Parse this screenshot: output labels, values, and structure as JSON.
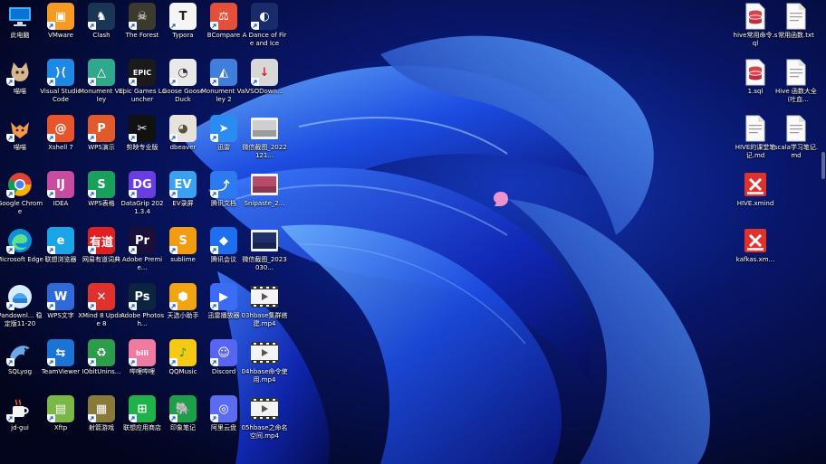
{
  "desktop": {
    "left_columns": [
      [
        {
          "name": "this-pc",
          "label": "此电脑",
          "kind": "pc",
          "color": "#1e90ff",
          "arrow": false
        },
        {
          "name": "meow",
          "label": "喵喵",
          "kind": "cat",
          "color": "#c9a37a",
          "arrow": true
        },
        {
          "name": "meowmeow",
          "label": "喵喵",
          "kind": "fox",
          "color": "#2aa1ff",
          "arrow": true
        },
        {
          "name": "google-chrome",
          "label": "Google Chrome",
          "kind": "chrome",
          "color": "#34a853",
          "arrow": true
        },
        {
          "name": "microsoft-edge",
          "label": "Microsoft Edge",
          "kind": "edge",
          "color": "#0a7ed9",
          "arrow": true
        },
        {
          "name": "pandownload",
          "label": "Pandownl... 稳定版11-20",
          "kind": "pan",
          "color": "#4fb3ff",
          "arrow": true
        },
        {
          "name": "sqlyog",
          "label": "SQLyog",
          "kind": "dolphin",
          "color": "#3b84d8",
          "arrow": true
        },
        {
          "name": "jd-gui",
          "label": "jd-gui",
          "kind": "coffee",
          "color": "#e6a23c",
          "arrow": true
        }
      ],
      [
        {
          "name": "vmware",
          "label": "VMware",
          "kind": "text",
          "text": "▣",
          "color": "#f59a23",
          "arrow": true
        },
        {
          "name": "vs-code",
          "label": "Visual Studio Code",
          "kind": "text",
          "text": "⟩⟨",
          "color": "#1e88e5",
          "arrow": true
        },
        {
          "name": "xshell",
          "label": "Xshell 7",
          "kind": "text",
          "text": "@",
          "color": "#e8552d",
          "arrow": true
        },
        {
          "name": "idea",
          "label": "IDEA",
          "kind": "text",
          "text": "IJ",
          "color": "#c74b9e",
          "arrow": true
        },
        {
          "name": "lenovo-browser",
          "label": "联想浏览器",
          "kind": "text",
          "text": "e",
          "color": "#1aa5e8",
          "arrow": true
        },
        {
          "name": "wps-writer",
          "label": "WPS文字",
          "kind": "text",
          "text": "W",
          "color": "#2f6bd8",
          "arrow": true
        },
        {
          "name": "teamviewer",
          "label": "TeamViewer",
          "kind": "text",
          "text": "⇆",
          "color": "#1b74d3",
          "arrow": true
        },
        {
          "name": "xftp",
          "label": "Xftp",
          "kind": "text",
          "text": "▤",
          "color": "#7ab648",
          "arrow": true
        }
      ],
      [
        {
          "name": "clash",
          "label": "Clash",
          "kind": "text",
          "text": "♞",
          "color": "#1b3557",
          "arrow": true
        },
        {
          "name": "monument-valley",
          "label": "Monument Valley",
          "kind": "text",
          "text": "△",
          "color": "#2fa88b",
          "arrow": true
        },
        {
          "name": "wps-presentation",
          "label": "WPS演示",
          "kind": "text",
          "text": "P",
          "color": "#e05a2b",
          "arrow": true
        },
        {
          "name": "wps-spreadsheet",
          "label": "WPS表格",
          "kind": "text",
          "text": "S",
          "color": "#19a05a",
          "arrow": true
        },
        {
          "name": "youdao-dict",
          "label": "网易有道词典",
          "kind": "text",
          "text": "有道",
          "color": "#e02020",
          "arrow": true
        },
        {
          "name": "xmind8",
          "label": "XMind 8 Update 8",
          "kind": "text",
          "text": "✕",
          "color": "#e0322d",
          "arrow": true
        },
        {
          "name": "iobit-uninstaller",
          "label": "IObitUnins...",
          "kind": "text",
          "text": "♻",
          "color": "#2c9d4a",
          "arrow": true
        },
        {
          "name": "lenovo-games",
          "label": "射箭游戏",
          "kind": "text",
          "text": "▦",
          "color": "#8a7a3a",
          "arrow": true
        }
      ],
      [
        {
          "name": "the-forest",
          "label": "The Forest",
          "kind": "text",
          "text": "☠",
          "color": "#3a3a2e",
          "arrow": true
        },
        {
          "name": "epic-games",
          "label": "Epic Games Launcher",
          "kind": "text",
          "text": "EPIC",
          "color": "#1a1a1a",
          "arrow": true
        },
        {
          "name": "capcut",
          "label": "剪映专业版",
          "kind": "text",
          "text": "✂",
          "color": "#111111",
          "arrow": true
        },
        {
          "name": "datagrip",
          "label": "DataGrip 2021.3.4",
          "kind": "text",
          "text": "DG",
          "color": "#6a3de0",
          "arrow": true
        },
        {
          "name": "adobe-premiere",
          "label": "Adobe Premie...",
          "kind": "text",
          "text": "Pr",
          "color": "#1b0f3a",
          "arrow": true
        },
        {
          "name": "adobe-photoshop",
          "label": "Adobe Photosh...",
          "kind": "text",
          "text": "Ps",
          "color": "#0b2540",
          "arrow": true
        },
        {
          "name": "bilibili",
          "label": "哔哩哔哩",
          "kind": "text",
          "text": "bili",
          "color": "#f07aa0",
          "arrow": true
        },
        {
          "name": "lenovo-app-store",
          "label": "联想应用商店",
          "kind": "text",
          "text": "⊞",
          "color": "#1fb24b",
          "arrow": true
        }
      ],
      [
        {
          "name": "typora",
          "label": "Typora",
          "kind": "text",
          "text": "T",
          "color": "#f5f5f5",
          "fg": "#222",
          "arrow": true
        },
        {
          "name": "goose-goose-duck",
          "label": "Goose Goose Duck",
          "kind": "text",
          "text": "◔",
          "color": "#e9e9e9",
          "fg": "#333",
          "arrow": true
        },
        {
          "name": "dbeaver",
          "label": "dbeaver",
          "kind": "text",
          "text": "◕",
          "color": "#e7e3dc",
          "fg": "#553",
          "arrow": true
        },
        {
          "name": "ev-recorder",
          "label": "EV录屏",
          "kind": "text",
          "text": "EV",
          "color": "#3aa0f0",
          "arrow": true
        },
        {
          "name": "sublime",
          "label": "sublime",
          "kind": "text",
          "text": "S",
          "color": "#f39c12",
          "arrow": true
        },
        {
          "name": "tianxuan-assistant",
          "label": "天选小助手",
          "kind": "text",
          "text": "⬢",
          "color": "#f2a510",
          "arrow": true
        },
        {
          "name": "qqmusic",
          "label": "QQMusic",
          "kind": "text",
          "text": "♪",
          "color": "#f6c915",
          "fg": "#1a9b3a",
          "arrow": true
        },
        {
          "name": "evernote",
          "label": "印象笔记",
          "kind": "text",
          "text": "🐘",
          "color": "#1f9e4a",
          "arrow": true
        }
      ],
      [
        {
          "name": "bcompare",
          "label": "BCompare",
          "kind": "text",
          "text": "⚖",
          "color": "#e44f3a",
          "arrow": true
        },
        {
          "name": "monument-valley-2",
          "label": "Monument Valley 2",
          "kind": "text",
          "text": "◭",
          "color": "#3f7fd9",
          "arrow": true
        },
        {
          "name": "xunlei",
          "label": "迅雷",
          "kind": "text",
          "text": "➤",
          "color": "#2a8cf0",
          "arrow": true
        },
        {
          "name": "tencent-docs",
          "label": "腾讯文档",
          "kind": "text",
          "text": "⤴",
          "color": "#2d7af0",
          "arrow": true
        },
        {
          "name": "tencent-meeting",
          "label": "腾讯会议",
          "kind": "text",
          "text": "◆",
          "color": "#1e6ef0",
          "arrow": true
        },
        {
          "name": "thunder-player",
          "label": "迅雷播放器",
          "kind": "text",
          "text": "▶",
          "color": "#3a6cf5",
          "arrow": true
        },
        {
          "name": "discord",
          "label": "Discord",
          "kind": "text",
          "text": "☺",
          "color": "#5865f2",
          "arrow": true
        },
        {
          "name": "aliyun-drive",
          "label": "阿里云盘",
          "kind": "text",
          "text": "◎",
          "color": "#5b6cf0",
          "arrow": true
        }
      ],
      [
        {
          "name": "a-dance-of-fire-and-ice",
          "label": "A Dance of Fire and Ice",
          "kind": "text",
          "text": "◐",
          "color": "#1a2b6b",
          "arrow": true
        },
        {
          "name": "vsodownloader",
          "label": "VSODown...",
          "kind": "text",
          "text": "↓",
          "color": "#d8d8d8",
          "fg": "#d22",
          "arrow": true
        },
        {
          "name": "wechat-screenshot-1",
          "label": "微信截图_2022121...",
          "kind": "thumb",
          "color": "#cfcfcf",
          "arrow": false
        },
        {
          "name": "snipaste-image",
          "label": "Snipaste_2...",
          "kind": "thumb",
          "color": "#b84a6a",
          "arrow": false
        },
        {
          "name": "wechat-screenshot-2",
          "label": "微信截图_2023030...",
          "kind": "thumb",
          "color": "#20306a",
          "arrow": false
        },
        {
          "name": "video-03hbase",
          "label": "03hbase集群搭建.mp4",
          "kind": "video",
          "color": "#f0f0f0",
          "arrow": false
        },
        {
          "name": "video-04hbase",
          "label": "04hbase命令使用.mp4",
          "kind": "video",
          "color": "#f0f0f0",
          "arrow": false
        },
        {
          "name": "video-05hbase",
          "label": "05hbase之命名空间.mp4",
          "kind": "video",
          "color": "#f0f0f0",
          "arrow": false
        }
      ]
    ],
    "right_columns": [
      [
        {
          "name": "hive-common-commands-sql",
          "label": "hive常用命令.sql",
          "kind": "sql",
          "color": "#ffffff",
          "arrow": false
        },
        {
          "name": "sql-file-1",
          "label": "1.sql",
          "kind": "sql",
          "color": "#ffffff",
          "arrow": false
        },
        {
          "name": "hive-class-notes-md",
          "label": "HIVE的课堂笔记.md",
          "kind": "doc",
          "color": "#ffffff",
          "arrow": false
        },
        {
          "name": "hive-xmind",
          "label": "HIVE.xmind",
          "kind": "xmind",
          "color": "#e0322d",
          "arrow": false
        },
        {
          "name": "kafkas-xmind",
          "label": "kafkas.xm...",
          "kind": "xmind",
          "color": "#e0322d",
          "arrow": false
        }
      ],
      [
        {
          "name": "common-functions-txt",
          "label": "常用函数.txt",
          "kind": "doc",
          "color": "#ffffff",
          "arrow": false
        },
        {
          "name": "hive-functions-doc",
          "label": "Hive 函数大全（吐血...",
          "kind": "doc",
          "color": "#ffffff",
          "arrow": false
        },
        {
          "name": "scala-notes-md",
          "label": "scala学习笔记.md",
          "kind": "doc",
          "color": "#ffffff",
          "arrow": false
        }
      ]
    ]
  }
}
